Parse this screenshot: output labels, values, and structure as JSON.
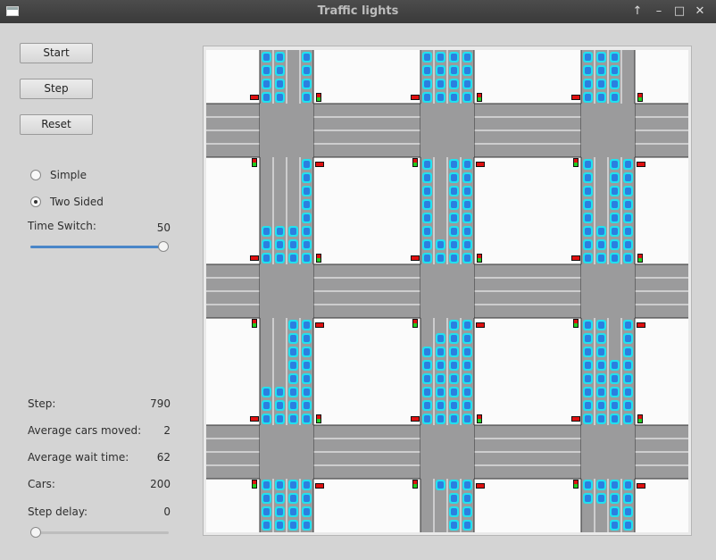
{
  "window": {
    "title": "Traffic lights"
  },
  "controls": {
    "start_label": "Start",
    "step_label": "Step",
    "reset_label": "Reset",
    "mode_options": [
      {
        "label": "Simple",
        "selected": false
      },
      {
        "label": "Two Sided",
        "selected": true
      }
    ],
    "time_switch": {
      "label": "Time Switch:",
      "value": "50",
      "fraction": 1.0
    },
    "step_delay": {
      "label": "Step delay:",
      "value": "0",
      "fraction": 0.0
    }
  },
  "stats": [
    {
      "label": "Step:",
      "value": "790"
    },
    {
      "label": "Average cars moved:",
      "value": "2"
    },
    {
      "label": "Average wait time:",
      "value": "62"
    },
    {
      "label": "Cars:",
      "value": "200"
    }
  ],
  "simulation": {
    "colors": {
      "road": "#9b9b9c",
      "block": "#fbfbfb",
      "car_outline": "#22e0ee",
      "car_body": "#2b7fe0",
      "light_red": "#e01010",
      "light_green": "#22cc22"
    },
    "grid": {
      "columns": 3,
      "rows": 3
    },
    "queues": [
      {
        "column": 0,
        "row": 0,
        "lane_cars": [
          4,
          4,
          0,
          4
        ]
      },
      {
        "column": 1,
        "row": 0,
        "lane_cars": [
          4,
          4,
          4,
          4
        ]
      },
      {
        "column": 2,
        "row": 0,
        "lane_cars": [
          4,
          4,
          4,
          0
        ]
      },
      {
        "column": 0,
        "row": 1,
        "lane_cars": [
          3,
          3,
          3,
          8
        ]
      },
      {
        "column": 1,
        "row": 1,
        "lane_cars": [
          8,
          2,
          8,
          8
        ]
      },
      {
        "column": 2,
        "row": 1,
        "lane_cars": [
          9,
          3,
          8,
          8
        ]
      },
      {
        "column": 0,
        "row": 2,
        "lane_cars": [
          3,
          3,
          8,
          8
        ]
      },
      {
        "column": 1,
        "row": 2,
        "lane_cars": [
          6,
          7,
          8,
          8
        ]
      },
      {
        "column": 2,
        "row": 2,
        "lane_cars": [
          8,
          8,
          5,
          8
        ]
      },
      {
        "column": 0,
        "row": 3,
        "lane_cars": [
          4,
          4,
          4,
          4
        ]
      },
      {
        "column": 1,
        "row": 3,
        "lane_cars": [
          0,
          1,
          4,
          4
        ]
      },
      {
        "column": 2,
        "row": 3,
        "lane_cars": [
          2,
          2,
          4,
          4
        ]
      }
    ]
  }
}
